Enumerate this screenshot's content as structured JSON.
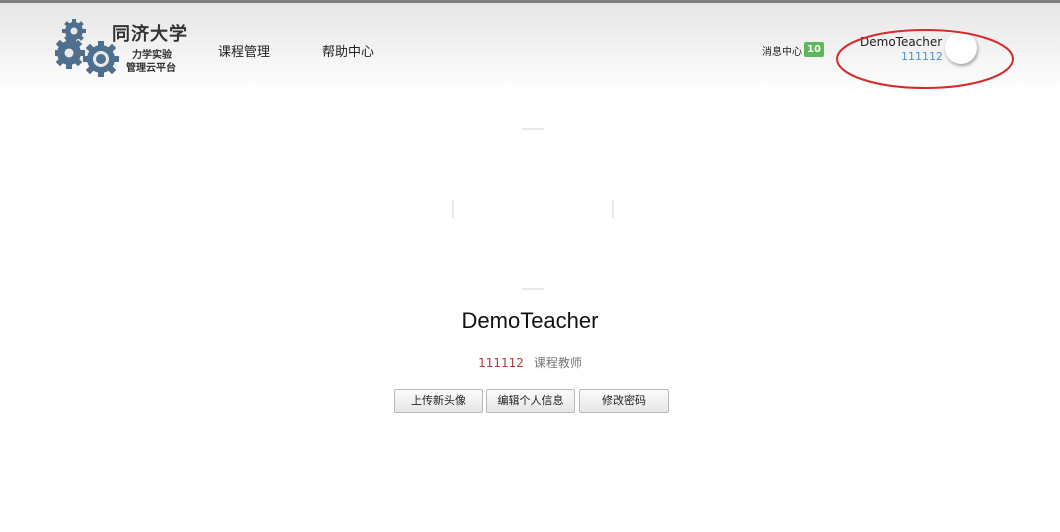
{
  "header": {
    "logo": {
      "university": "同济大学",
      "subtitle_line1": "力学实验",
      "subtitle_line2": "管理云平台"
    },
    "nav": [
      {
        "label": "课程管理"
      },
      {
        "label": "帮助中心"
      }
    ],
    "messages": {
      "label": "消息中心",
      "count": "10"
    },
    "user": {
      "name": "DemoTeacher",
      "id": "111112"
    }
  },
  "profile": {
    "name": "DemoTeacher",
    "id": "111112",
    "role": "课程教师",
    "actions": [
      {
        "label": "上传新头像"
      },
      {
        "label": "编辑个人信息"
      },
      {
        "label": "修改密码"
      }
    ]
  },
  "colors": {
    "badge": "#5bb75b",
    "user_id": "#4a8fd6",
    "profile_id": "#b03a3a",
    "highlight": "#d42b2b"
  }
}
